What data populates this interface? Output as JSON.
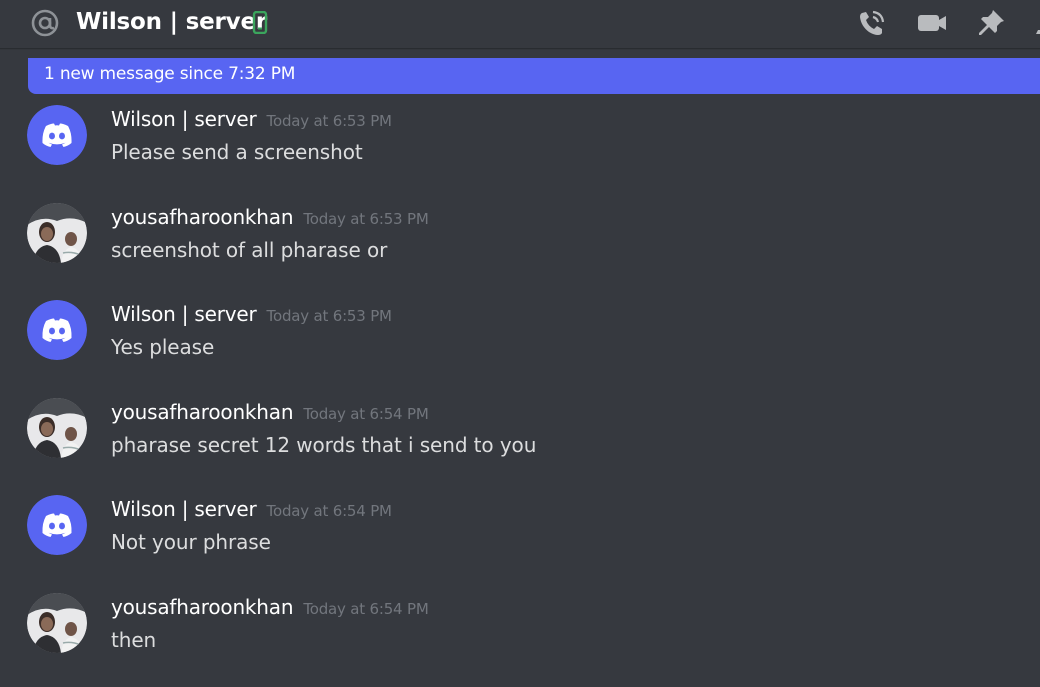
{
  "header": {
    "title": "Wilson | server",
    "icons": [
      "at-icon",
      "mobile-icon",
      "phone-call-icon",
      "video-camera-icon",
      "pin-icon"
    ]
  },
  "banner": {
    "text": "1 new message since 7:32 PM"
  },
  "messages": [
    {
      "author": "Wilson | server",
      "time": "Today at 6:53 PM",
      "text": "Please send a screenshot",
      "avatar": "discord-logo"
    },
    {
      "author": "yousafharoonkhan",
      "time": "Today at 6:53 PM",
      "text": "screenshot of all pharase or",
      "avatar": "photo"
    },
    {
      "author": "Wilson | server",
      "time": "Today at 6:53 PM",
      "text": "Yes please",
      "avatar": "discord-logo"
    },
    {
      "author": "yousafharoonkhan",
      "time": "Today at 6:54 PM",
      "text": "pharase secret 12 words that i send to you",
      "avatar": "photo"
    },
    {
      "author": "Wilson | server",
      "time": "Today at 6:54 PM",
      "text": "Not your phrase",
      "avatar": "discord-logo"
    },
    {
      "author": "yousafharoonkhan",
      "time": "Today at 6:54 PM",
      "text": "then",
      "avatar": "photo"
    }
  ],
  "colors": {
    "background": "#36393f",
    "banner": "#5865f2",
    "discord_blurple": "#5865f2",
    "timestamp": "#72767d",
    "mobile_status": "#3ba55d"
  }
}
